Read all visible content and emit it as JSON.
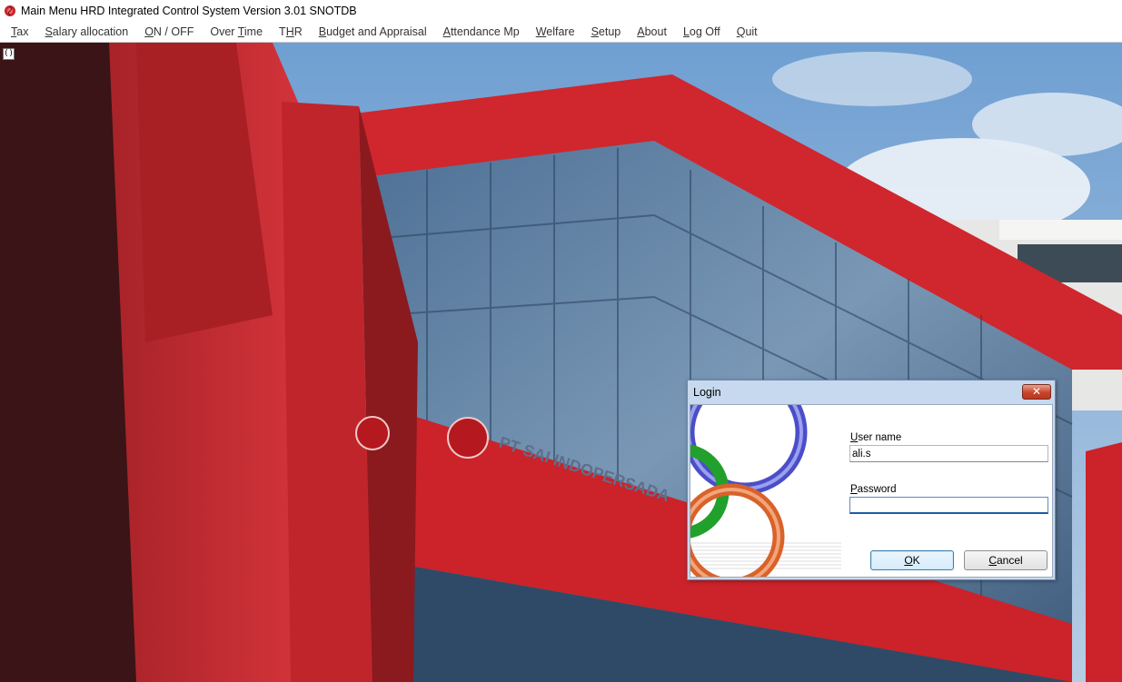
{
  "window": {
    "title": "Main Menu HRD Integrated Control System Version 3.01 SNOTDB",
    "app_icon": "rose-logo-icon"
  },
  "menu": [
    {
      "pre": "",
      "key": "T",
      "post": "ax"
    },
    {
      "pre": "",
      "key": "S",
      "post": "alary allocation"
    },
    {
      "pre": "",
      "key": "O",
      "post": "N / OFF"
    },
    {
      "pre": "Over ",
      "key": "T",
      "post": "ime"
    },
    {
      "pre": "T",
      "key": "H",
      "post": "R"
    },
    {
      "pre": "",
      "key": "B",
      "post": "udget and Appraisal"
    },
    {
      "pre": "",
      "key": "A",
      "post": "ttendance Mp"
    },
    {
      "pre": "",
      "key": "W",
      "post": "elfare"
    },
    {
      "pre": "",
      "key": "S",
      "post": "etup"
    },
    {
      "pre": "",
      "key": "A",
      "post": "bout"
    },
    {
      "pre": "",
      "key": "L",
      "post": "og Off"
    },
    {
      "pre": "",
      "key": "Q",
      "post": "uit"
    }
  ],
  "mdi_icon_label": "()",
  "background": {
    "sign_text": "PT SAI INDOPERSADA",
    "accent_red": "#c8232b",
    "sky_blue": "#8fb2d8"
  },
  "dialog": {
    "title": "Login",
    "close_label": "✕",
    "username": {
      "pre": "",
      "key": "U",
      "post": "ser name",
      "value": "ali.s"
    },
    "password": {
      "pre": "",
      "key": "P",
      "post": "assword",
      "value": ""
    },
    "ok": {
      "key": "O",
      "post": "K"
    },
    "cancel": {
      "key": "C",
      "post": "ancel"
    }
  }
}
